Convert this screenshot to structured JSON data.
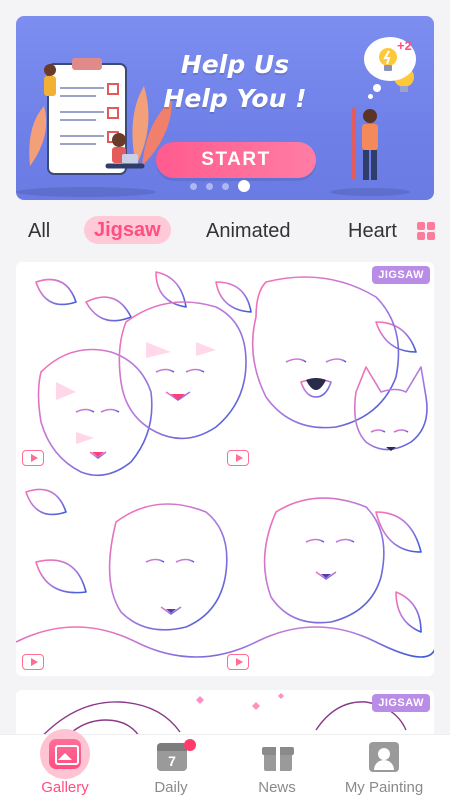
{
  "banner": {
    "title_line1": "Help Us",
    "title_line2": "Help You !",
    "start_label": "START",
    "badge": "+2"
  },
  "tabs": [
    {
      "label": "All"
    },
    {
      "label": "Jigsaw",
      "selected": true
    },
    {
      "label": "Animated"
    },
    {
      "label": "Heart"
    }
  ],
  "cards": [
    {
      "badge": "JIGSAW"
    },
    {
      "badge": "JIGSAW"
    }
  ],
  "bottom_nav": [
    {
      "label": "Gallery",
      "active": true
    },
    {
      "label": "Daily",
      "badge_number": "7"
    },
    {
      "label": "News"
    },
    {
      "label": "My Painting"
    }
  ],
  "colors": {
    "accent": "#ff4f80",
    "banner": "#7587ec",
    "badge": "#b98ce6"
  }
}
